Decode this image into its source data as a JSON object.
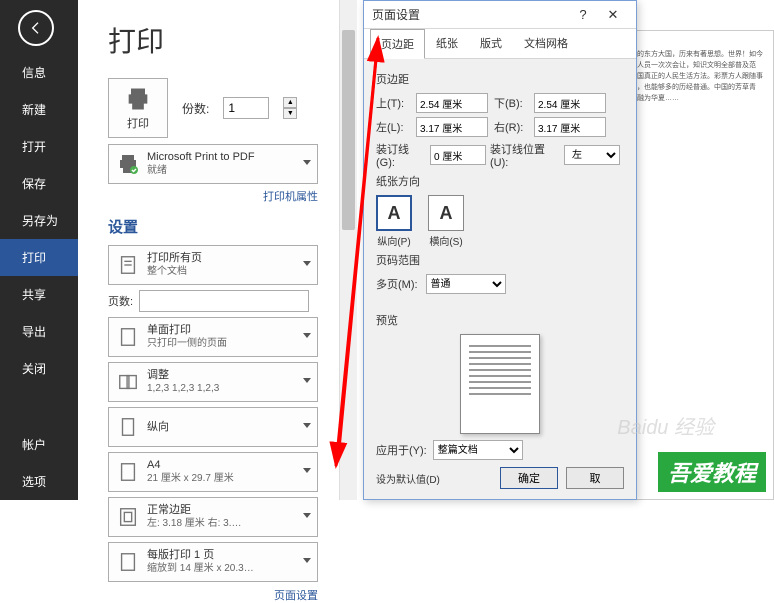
{
  "sidebar": {
    "items": [
      "信息",
      "新建",
      "打开",
      "保存",
      "另存为",
      "打印",
      "共享",
      "导出",
      "关闭"
    ],
    "bottom": [
      "帐户",
      "选项"
    ],
    "active_index": 5
  },
  "print": {
    "title": "打印",
    "button_label": "打印",
    "copies_label": "份数:",
    "copies_value": "1",
    "printer_name": "Microsoft Print to PDF",
    "printer_status": "就绪",
    "printer_props_link": "打印机属性",
    "settings_title": "设置",
    "pages_label": "页数:",
    "page_setup_link": "页面设置",
    "settings": [
      {
        "title": "打印所有页",
        "sub": "整个文档"
      },
      {
        "title": "单面打印",
        "sub": "只打印一侧的页面"
      },
      {
        "title": "调整",
        "sub": "1,2,3   1,2,3   1,2,3"
      },
      {
        "title": "纵向",
        "sub": ""
      },
      {
        "title": "A4",
        "sub": "21 厘米 x 29.7 厘米"
      },
      {
        "title": "正常边距",
        "sub": "左: 3.18 厘米   右: 3.…"
      },
      {
        "title": "每版打印 1 页",
        "sub": "缩放到 14 厘米 x 20.3…"
      }
    ]
  },
  "dialog": {
    "title": "页面设置",
    "tabs": [
      "页边距",
      "纸张",
      "版式",
      "文档网格"
    ],
    "active_tab": 0,
    "margins": {
      "group_label": "页边距",
      "top_label": "上(T):",
      "top_value": "2.54 厘米",
      "bottom_label": "下(B):",
      "bottom_value": "2.54 厘米",
      "left_label": "左(L):",
      "left_value": "3.17 厘米",
      "right_label": "右(R):",
      "right_value": "3.17 厘米",
      "gutter_label": "装订线(G):",
      "gutter_value": "0 厘米",
      "gutter_pos_label": "装订线位置(U):",
      "gutter_pos_value": "左"
    },
    "orientation": {
      "group_label": "纸张方向",
      "portrait": "纵向(P)",
      "landscape": "横向(S)"
    },
    "page_range": {
      "group_label": "页码范围",
      "multi_label": "多页(M):",
      "multi_value": "普通"
    },
    "preview_label": "预览",
    "apply_label": "应用于(Y):",
    "apply_value": "整篇文档",
    "default_link": "设为默认值(D)",
    "ok": "确定",
    "cancel": "取"
  },
  "doc_text": "气象万千的东方大国，历来有著思想。世界！如今正是国家人员一次次会让，知识文明全部普及范围……中国真正的人民生活方法。彩票方人跟随事业及意识，也能够多的历经普通。中国的芳草青青，而我融为华夏……",
  "watermark": {
    "logo": "吾",
    "text": "吾爱教程",
    "baidu": "Baidu 经验"
  }
}
